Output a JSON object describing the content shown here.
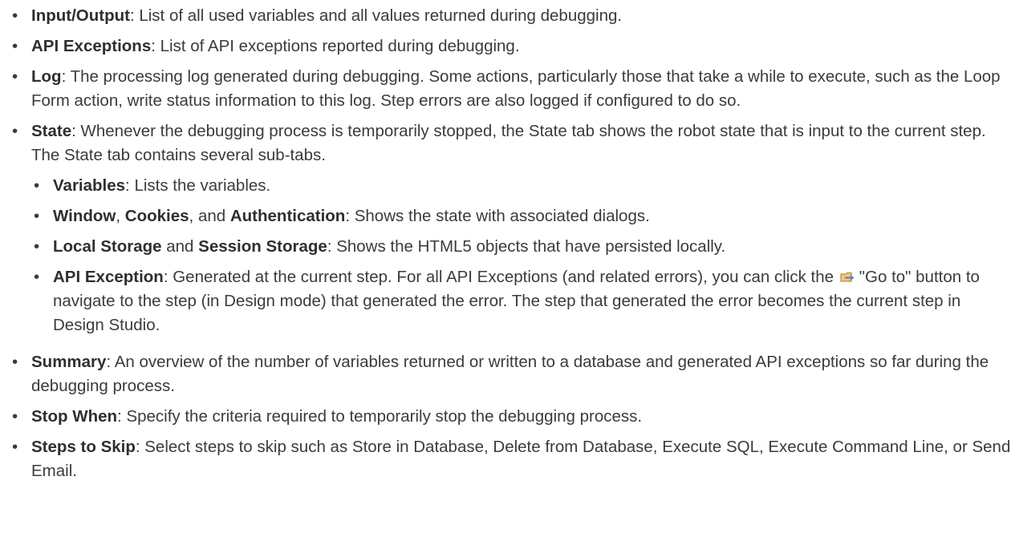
{
  "items": [
    {
      "term": "Input/Output",
      "text": ": List of all used variables and all values returned during debugging."
    },
    {
      "term": "API Exceptions",
      "text": ": List of API exceptions reported during debugging."
    },
    {
      "term": "Log",
      "text": ": The processing log generated during debugging. Some actions, particularly those that take a while to execute, such as the Loop Form action, write status information to this log. Step errors are also logged if configured to do so."
    },
    {
      "term": "State",
      "text": ": Whenever the debugging process is temporarily stopped, the State tab shows the robot state that is input to the current step. The State tab contains several sub-tabs.",
      "sub": {
        "variables": {
          "term": "Variables",
          "text": ": Lists the variables."
        },
        "window": {
          "term1": "Window",
          "sep1": ", ",
          "term2": "Cookies",
          "sep2": ", and ",
          "term3": "Authentication",
          "text": ": Shows the state with associated dialogs."
        },
        "storage": {
          "term1": "Local Storage",
          "sep1": " and ",
          "term2": "Session Storage",
          "text": ": Shows the HTML5 objects that have persisted locally."
        },
        "api_exception": {
          "term": "API Exception",
          "text_before_icon": ": Generated at the current step. For all API Exceptions (and related errors), you can click the",
          "icon": "go-to-icon",
          "text_after_icon": "\"Go to\" button to navigate to the step (in Design mode) that generated the error. The step that generated the error becomes the current step in Design Studio."
        }
      }
    },
    {
      "term": "Summary",
      "text": ": An overview of the number of variables returned or written to a database and generated API exceptions so far during the debugging process."
    },
    {
      "term": "Stop When",
      "text": ": Specify the criteria required to temporarily stop the debugging process."
    },
    {
      "term": "Steps to Skip",
      "text": ": Select steps to skip such as Store in Database, Delete from Database, Execute SQL, Execute Command Line, or Send Email."
    }
  ],
  "bullet_char": "•",
  "colors": {
    "text": "#3b3b3b",
    "icon_fill": "#f3c778",
    "icon_stroke": "#b07a20",
    "icon_arrow": "#4a86c8"
  }
}
